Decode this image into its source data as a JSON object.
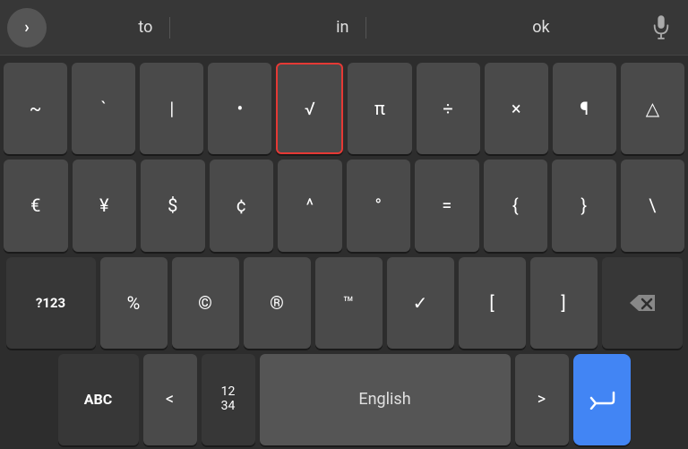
{
  "suggestions": {
    "items": [
      "to",
      "in",
      "ok"
    ]
  },
  "keyboard": {
    "rows": [
      {
        "keys": [
          {
            "label": "~",
            "type": "normal"
          },
          {
            "label": "`",
            "type": "normal"
          },
          {
            "label": "|",
            "type": "normal"
          },
          {
            "label": "•",
            "type": "normal"
          },
          {
            "label": "√",
            "type": "highlighted"
          },
          {
            "label": "π",
            "type": "normal"
          },
          {
            "label": "÷",
            "type": "normal"
          },
          {
            "label": "×",
            "type": "normal"
          },
          {
            "label": "¶",
            "type": "normal"
          },
          {
            "label": "△",
            "type": "normal"
          }
        ]
      },
      {
        "keys": [
          {
            "label": "€",
            "type": "normal"
          },
          {
            "label": "¥",
            "type": "normal"
          },
          {
            "label": "$",
            "type": "normal"
          },
          {
            "label": "¢",
            "type": "normal"
          },
          {
            "label": "^",
            "type": "normal"
          },
          {
            "label": "°",
            "type": "normal"
          },
          {
            "label": "=",
            "type": "normal"
          },
          {
            "label": "{",
            "type": "normal"
          },
          {
            "label": "}",
            "type": "normal"
          },
          {
            "label": "\\",
            "type": "normal"
          }
        ]
      },
      {
        "keys": [
          {
            "label": "?123",
            "type": "action"
          },
          {
            "label": "%",
            "type": "normal"
          },
          {
            "label": "©",
            "type": "normal"
          },
          {
            "label": "®",
            "type": "normal"
          },
          {
            "label": "™",
            "type": "normal"
          },
          {
            "label": "✓",
            "type": "normal"
          },
          {
            "label": "[",
            "type": "normal"
          },
          {
            "label": "]",
            "type": "normal"
          },
          {
            "label": "⌫",
            "type": "backspace"
          }
        ]
      },
      {
        "keys": [
          {
            "label": "ABC",
            "type": "action"
          },
          {
            "label": "<",
            "type": "normal"
          },
          {
            "label": "1234",
            "type": "stacked"
          },
          {
            "label": "English",
            "type": "spacebar"
          },
          {
            "label": ">",
            "type": "normal"
          },
          {
            "label": "↵",
            "type": "enter"
          }
        ]
      }
    ],
    "bottomRow": {
      "abc_label": "ABC",
      "less_label": "<",
      "numbers_top": "12",
      "numbers_bottom": "34",
      "spacebar_label": "English",
      "greater_label": ">",
      "enter_label": "↵"
    }
  }
}
